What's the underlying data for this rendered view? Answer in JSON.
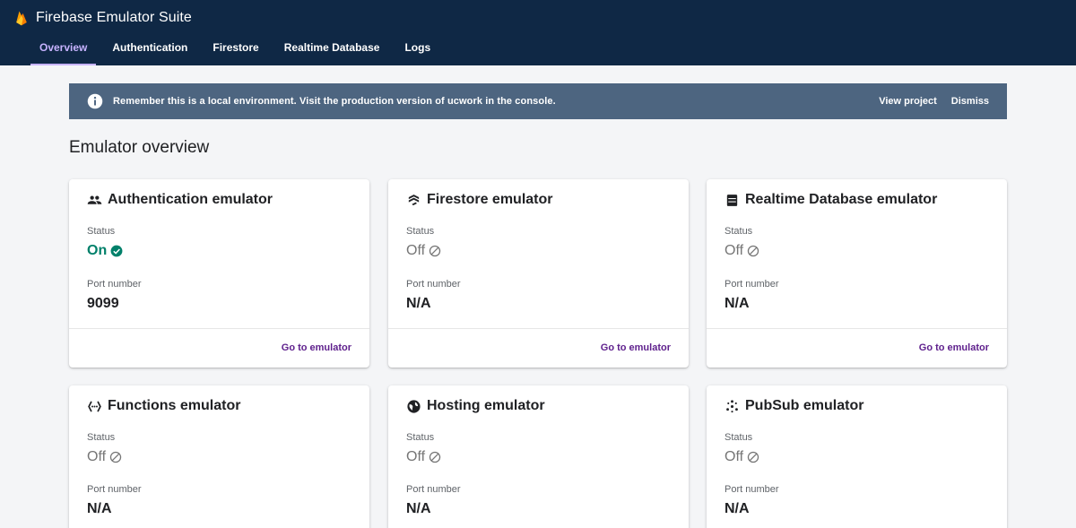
{
  "app": {
    "title": "Firebase Emulator Suite",
    "logo_icon": "firebase-flame-icon"
  },
  "nav": {
    "tabs": [
      {
        "label": "Overview",
        "active": true
      },
      {
        "label": "Authentication",
        "active": false
      },
      {
        "label": "Firestore",
        "active": false
      },
      {
        "label": "Realtime Database",
        "active": false
      },
      {
        "label": "Logs",
        "active": false
      }
    ]
  },
  "banner": {
    "icon": "info-icon",
    "message_before": "Remember this is a local environment. Visit the production version of ",
    "project_name": "ucwork",
    "message_after": " in the console.",
    "view_project": "View project",
    "dismiss": "Dismiss"
  },
  "page": {
    "title": "Emulator overview"
  },
  "labels": {
    "status": "Status",
    "port": "Port number",
    "go": "Go to emulator"
  },
  "emulators": [
    {
      "title": "Authentication emulator",
      "icon": "people-icon",
      "status": "On",
      "port": "9099"
    },
    {
      "title": "Firestore emulator",
      "icon": "firestore-icon",
      "status": "Off",
      "port": "N/A"
    },
    {
      "title": "Realtime Database emulator",
      "icon": "database-icon",
      "status": "Off",
      "port": "N/A"
    },
    {
      "title": "Functions emulator",
      "icon": "functions-icon",
      "status": "Off",
      "port": "N/A"
    },
    {
      "title": "Hosting emulator",
      "icon": "globe-icon",
      "status": "Off",
      "port": "N/A"
    },
    {
      "title": "PubSub emulator",
      "icon": "pubsub-icon",
      "status": "Off",
      "port": "N/A"
    }
  ],
  "colors": {
    "header_bg": "#0f2845",
    "active_tab": "#c7b3ff",
    "banner_bg": "#4d6580",
    "status_on": "#00806a",
    "status_off": "#757575",
    "link": "#5e1f8c"
  }
}
